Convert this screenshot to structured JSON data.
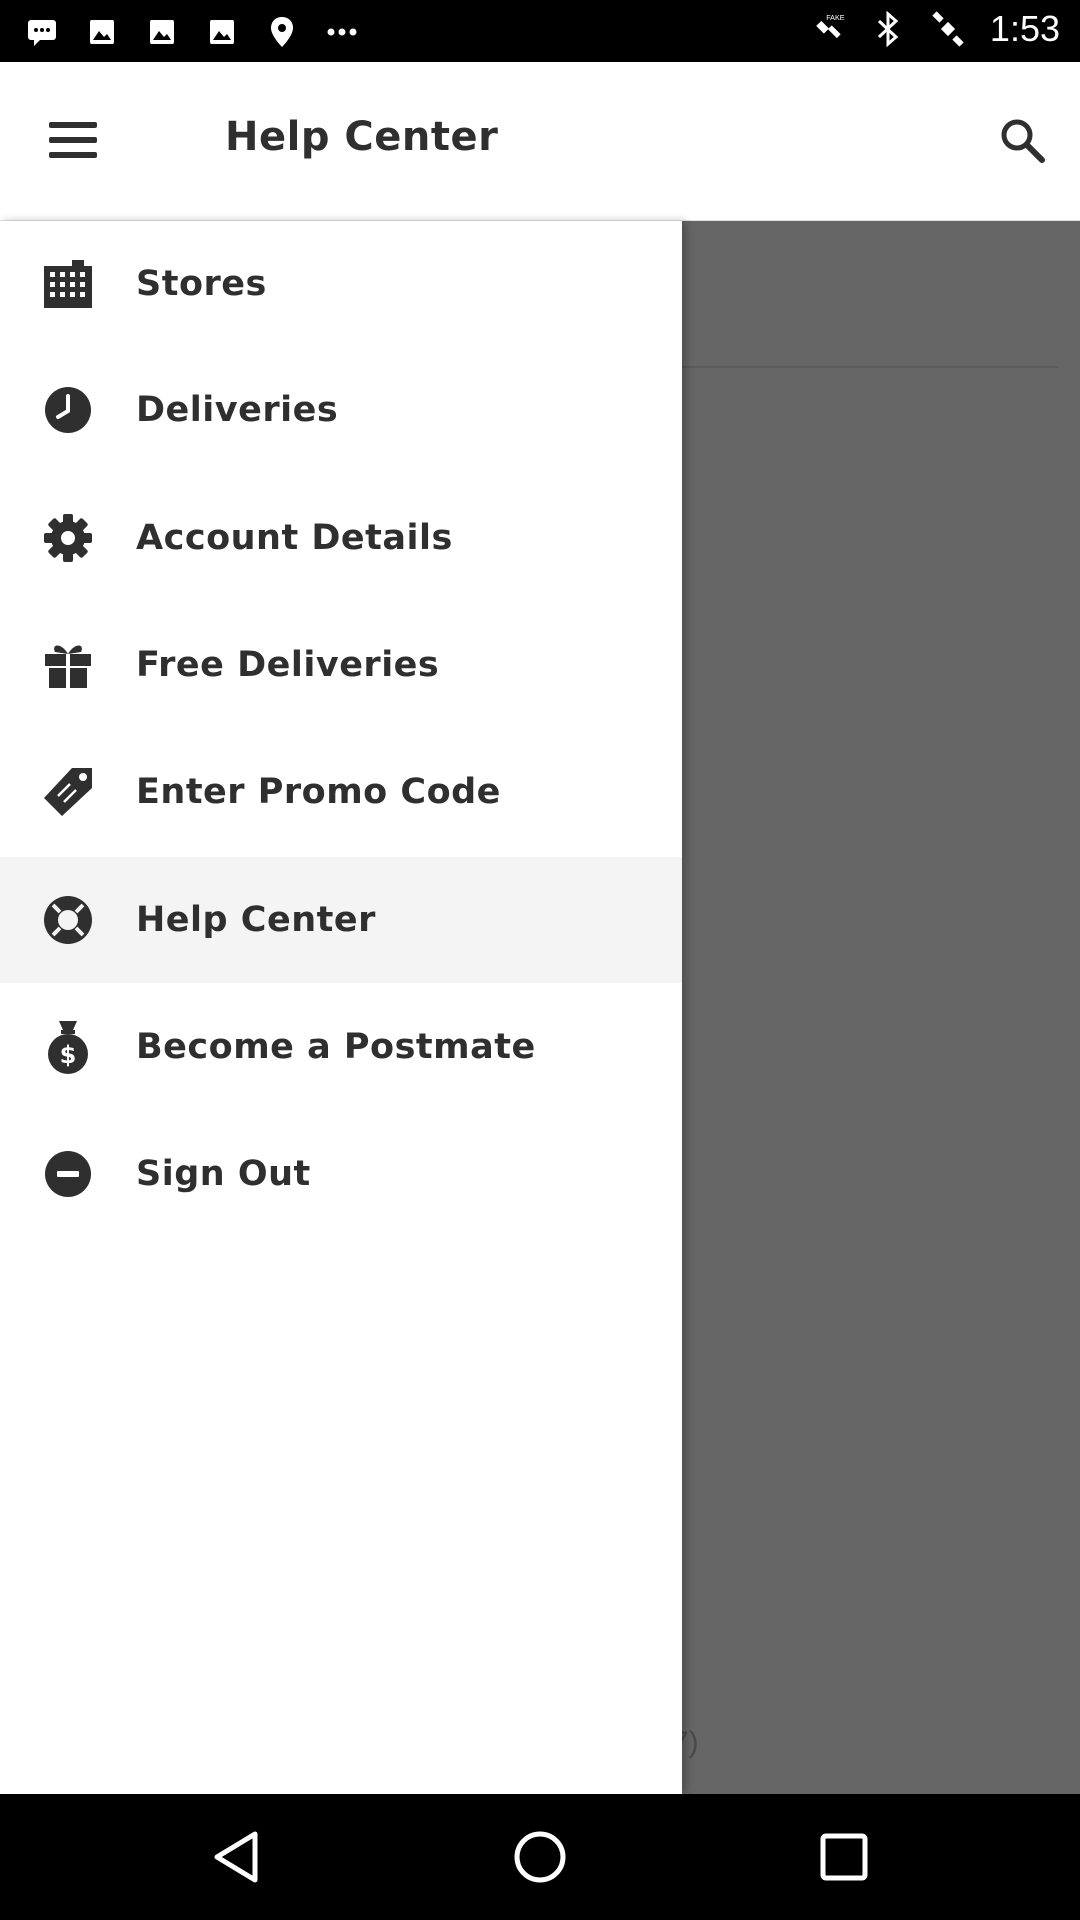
{
  "status_bar": {
    "time": "1:53",
    "left_icons": [
      "message-icon",
      "image-icon",
      "image-icon",
      "image-icon",
      "location-pin-icon",
      "more-dots-icon"
    ],
    "right_icons": [
      "fake-gps-icon",
      "bluetooth-icon",
      "satellite-icon"
    ]
  },
  "app_bar": {
    "title": "Help Center"
  },
  "drawer": {
    "items": [
      {
        "label": "Stores",
        "icon": "building-icon"
      },
      {
        "label": "Deliveries",
        "icon": "clock-icon"
      },
      {
        "label": "Account Details",
        "icon": "gear-icon"
      },
      {
        "label": "Free Deliveries",
        "icon": "gift-icon"
      },
      {
        "label": "Enter Promo Code",
        "icon": "tag-icon"
      },
      {
        "label": "Help Center",
        "icon": "lifebuoy-icon",
        "active": true
      },
      {
        "label": "Become a Postmate",
        "icon": "money-bag-icon"
      },
      {
        "label": "Sign Out",
        "icon": "minus-circle-icon"
      }
    ]
  },
  "background": {
    "partial_text": "7)"
  },
  "colors": {
    "text": "#2f2f2f",
    "backdrop": "#666666",
    "active_item": "#f4f4f4"
  }
}
